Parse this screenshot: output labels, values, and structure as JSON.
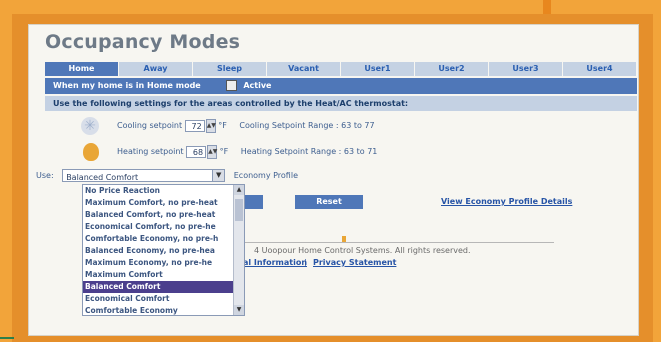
{
  "page": {
    "title": "Occupancy Modes"
  },
  "tabs": [
    "Home",
    "Away",
    "Sleep",
    "Vacant",
    "User1",
    "User2",
    "User3",
    "User4"
  ],
  "mode_bar": {
    "text": "When my home is in Home mode",
    "active_label": "Active",
    "active_checked": true
  },
  "settings_bar": {
    "text": "Use the following settings for the areas controlled by the Heat/AC thermostat:"
  },
  "cooling": {
    "label": "Cooling setpoint",
    "value": "72",
    "unit": "°F",
    "range": "Cooling Setpoint Range : 63 to 77"
  },
  "heating": {
    "label": "Heating setpoint",
    "value": "68",
    "unit": "°F",
    "range": "Heating Setpoint Range : 63 to 71"
  },
  "use": {
    "label": "Use:",
    "selected": "Balanced Comfort",
    "suffix": "Economy Profile"
  },
  "buttons": {
    "apply": "y",
    "reset": "Reset"
  },
  "links": {
    "view_economy": "View Economy Profile Details",
    "legal": "al Information",
    "privacy": "Privacy Statement",
    "separator": "|"
  },
  "footer": {
    "copyright": "4 Uoopour Home Control Systems. All rights reserved."
  },
  "dropdown": {
    "options": [
      "No Price Reaction",
      "Maximum Comfort, no pre-heat",
      "Balanced Comfort, no pre-heat",
      "Economical Comfort, no pre-he",
      "Comfortable Economy, no pre-h",
      "Balanced Economy, no pre-hea",
      "Maximum Economy, no pre-he",
      "Maximum Comfort",
      "Balanced Comfort",
      "Economical Comfort",
      "Comfortable Economy"
    ],
    "selected_index": 8
  },
  "icons": {
    "cooling": "snowflake-icon",
    "heating": "flame-icon"
  },
  "colors": {
    "accent": "#4f77b8",
    "frame": "#f2a43a",
    "selected_option": "#4b3f8d"
  }
}
